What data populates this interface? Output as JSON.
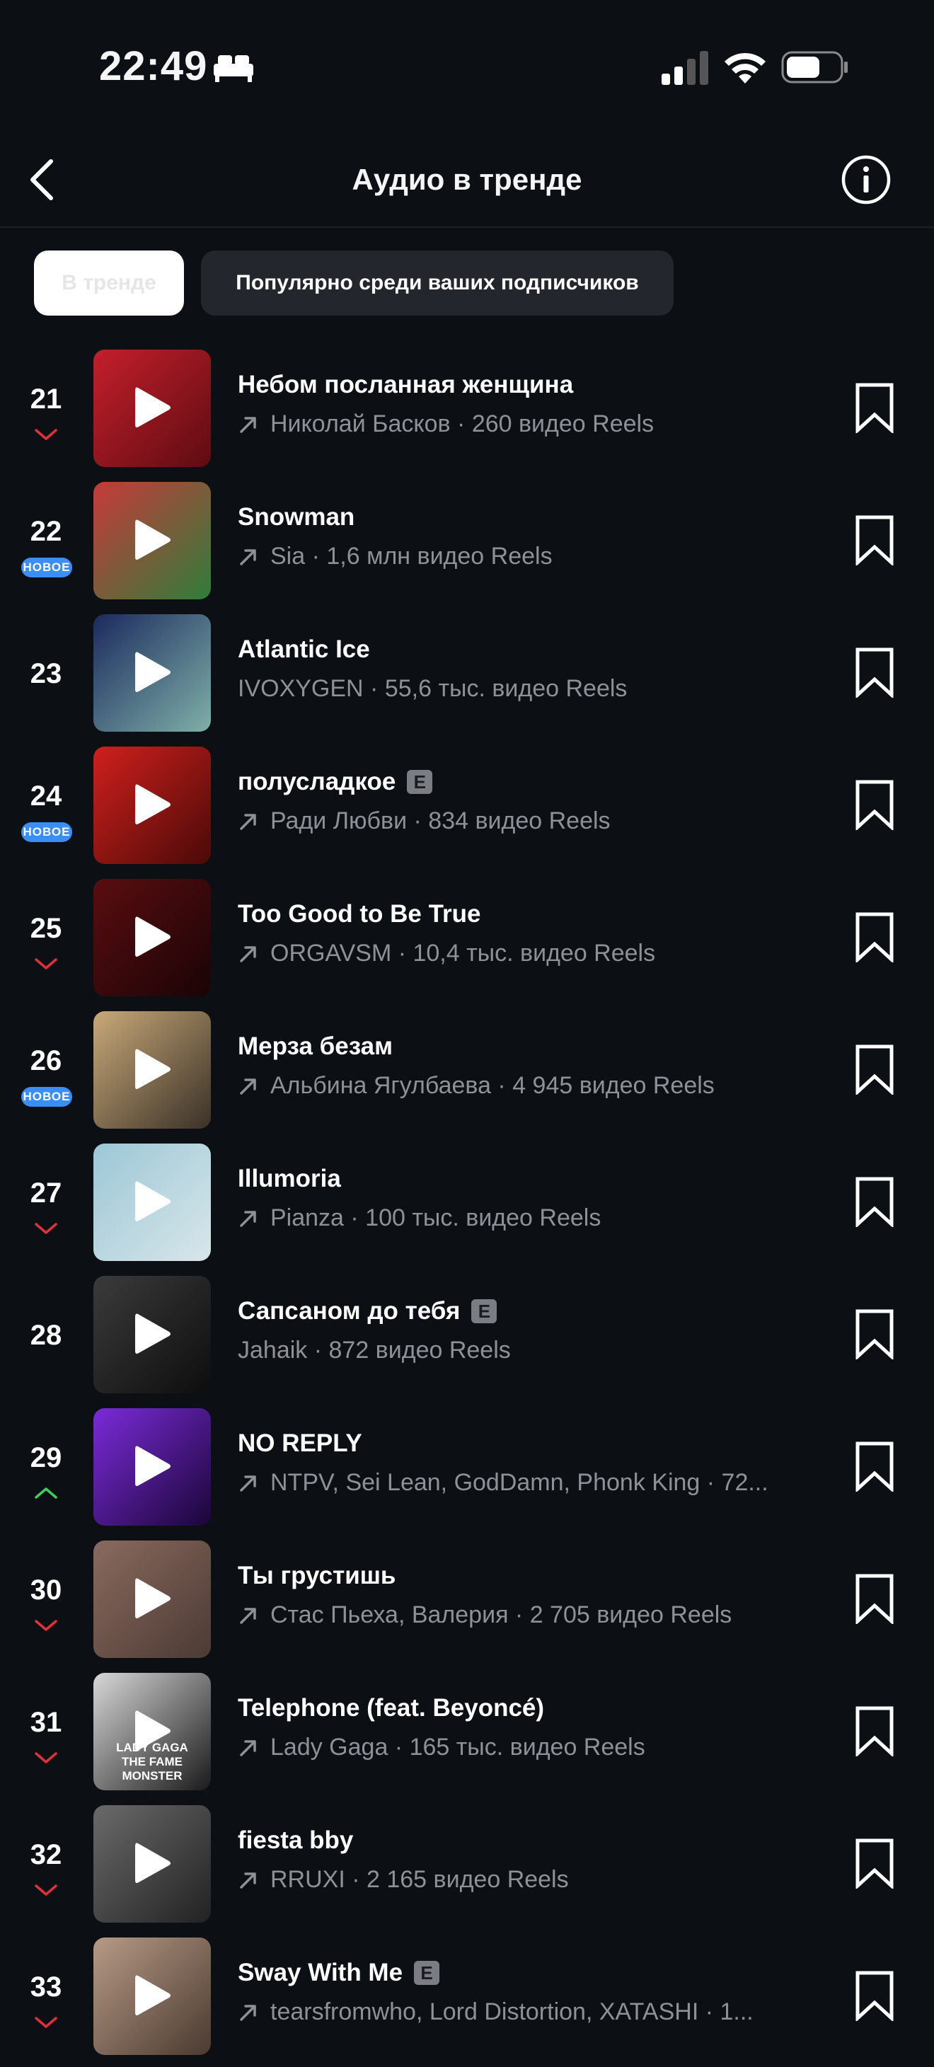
{
  "status_bar": {
    "time": "22:49"
  },
  "header": {
    "title": "Аудио в тренде"
  },
  "tabs": [
    {
      "label": "В тренде",
      "active": true
    },
    {
      "label": "Популярно среди ваших подписчиков",
      "active": false
    }
  ],
  "colors": {
    "background": "#0c0f14",
    "down": "#e0303a",
    "up": "#3ecf5b",
    "new_badge": "#3a8ef6",
    "secondary_text": "#8e9197"
  },
  "tracks": [
    {
      "rank": "21",
      "trend": "down",
      "title": "Небом посланная женщина",
      "explicit": false,
      "arrow": true,
      "meta": "Николай Басков · 260 видео Reels",
      "cover_colors": [
        "#c41f2b",
        "#5e0c12"
      ]
    },
    {
      "rank": "22",
      "trend": "new",
      "badge": "НОВОЕ",
      "title": "Snowman",
      "explicit": false,
      "arrow": true,
      "meta": "Sia · 1,6 млн видео Reels",
      "cover_colors": [
        "#c73a3a",
        "#2f7d3a"
      ]
    },
    {
      "rank": "23",
      "trend": "none",
      "title": "Atlantic Ice",
      "explicit": false,
      "arrow": false,
      "meta": "IVOXYGEN · 55,6 тыс. видео Reels",
      "cover_colors": [
        "#1b2a5e",
        "#7fb0a8"
      ]
    },
    {
      "rank": "24",
      "trend": "new",
      "badge": "НОВОЕ",
      "title": "полусладкое",
      "explicit": true,
      "explicit_label": "E",
      "arrow": true,
      "meta": "Ради Любви · 834 видео Reels",
      "cover_colors": [
        "#d0201c",
        "#4a0a08"
      ]
    },
    {
      "rank": "25",
      "trend": "down",
      "title": "Too Good to Be True",
      "explicit": false,
      "arrow": true,
      "meta": "ORGAVSM · 10,4 тыс. видео Reels",
      "cover_colors": [
        "#5a0d10",
        "#1a0406"
      ]
    },
    {
      "rank": "26",
      "trend": "new",
      "badge": "НОВОЕ",
      "title": "Мерза безам",
      "explicit": false,
      "arrow": true,
      "meta": "Альбина Ягулбаева · 4 945 видео Reels",
      "cover_colors": [
        "#c9a978",
        "#3a3128"
      ]
    },
    {
      "rank": "27",
      "trend": "down",
      "title": "Illumoria",
      "explicit": false,
      "arrow": true,
      "meta": "Pianza · 100 тыс. видео Reels",
      "cover_colors": [
        "#9cc7d6",
        "#d8e6ea"
      ]
    },
    {
      "rank": "28",
      "trend": "none",
      "title": "Сапсаном до тебя",
      "explicit": true,
      "explicit_label": "E",
      "arrow": false,
      "meta": "Jahaik · 872 видео Reels",
      "cover_colors": [
        "#3b3b3b",
        "#0d0d0d"
      ]
    },
    {
      "rank": "29",
      "trend": "up",
      "title": "NO REPLY",
      "explicit": false,
      "arrow": true,
      "meta": "NTPV, Sei Lean, GodDamn, Phonk King · 72...",
      "cover_colors": [
        "#7b2bd9",
        "#1a0638"
      ]
    },
    {
      "rank": "30",
      "trend": "down",
      "title": "Ты грустишь",
      "explicit": false,
      "arrow": true,
      "meta": "Стас Пьеха, Валерия · 2 705 видео Reels",
      "cover_colors": [
        "#8a6a5e",
        "#4b3a34"
      ]
    },
    {
      "rank": "31",
      "trend": "down",
      "title": "Telephone (feat. Beyoncé)",
      "explicit": false,
      "arrow": true,
      "meta": "Lady Gaga · 165 тыс. видео Reels",
      "cover_colors": [
        "#d8d8d8",
        "#1a1a1a"
      ],
      "cover_text": [
        "LADY GAGA",
        "THE FAME MONSTER"
      ]
    },
    {
      "rank": "32",
      "trend": "down",
      "title": "fiesta bby",
      "explicit": false,
      "arrow": true,
      "meta": "RRUXI · 2 165 видео Reels",
      "cover_colors": [
        "#6a6a6a",
        "#222222"
      ]
    },
    {
      "rank": "33",
      "trend": "down",
      "title": "Sway With Me",
      "explicit": true,
      "explicit_label": "E",
      "arrow": true,
      "meta": "tearsfromwho, Lord Distortion, XATASHI · 1...",
      "cover_colors": [
        "#b79a86",
        "#4a3a30"
      ]
    }
  ]
}
